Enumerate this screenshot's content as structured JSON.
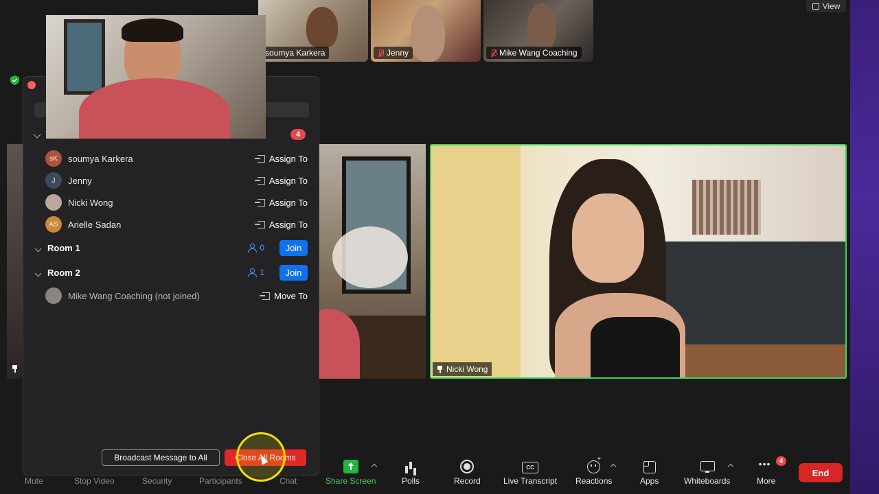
{
  "view_button": {
    "label": "View"
  },
  "thumbnails": [
    {
      "name": "soumya Karkera",
      "muted": false
    },
    {
      "name": "Jenny",
      "muted": true
    },
    {
      "name": "Mike Wang Coaching",
      "muted": true
    }
  ],
  "main_video": {
    "name": "Nicki Wong"
  },
  "breakout_panel": {
    "unassigned_count": "4",
    "participants": [
      {
        "initials": "sK",
        "name": "soumya Karkera",
        "action": "Assign To",
        "avatar_color": "#b0533d"
      },
      {
        "initials": "J",
        "name": "Jenny",
        "action": "Assign To",
        "avatar_color": "#3b4a5c"
      },
      {
        "initials": "",
        "name": "Nicki Wong",
        "action": "Assign To",
        "avatar_color": "#b8a8a0"
      },
      {
        "initials": "AS",
        "name": "Arielle Sadan",
        "action": "Assign To",
        "avatar_color": "#c9873a"
      }
    ],
    "rooms": [
      {
        "name": "Room 1",
        "count": "0",
        "action": "Join"
      },
      {
        "name": "Room 2",
        "count": "1",
        "action": "Join"
      }
    ],
    "room2_members": [
      {
        "name": "Mike Wang Coaching (not joined)",
        "action": "Move To"
      }
    ],
    "broadcast_label": "Broadcast Message to All",
    "close_all_label": "Close All Rooms"
  },
  "toolbar": {
    "mute": "Mute",
    "stop_video": "Stop Video",
    "security": "Security",
    "participants": "Participants",
    "chat": "Chat",
    "share_screen": "Share Screen",
    "polls": "Polls",
    "record": "Record",
    "live_transcript": "Live Transcript",
    "cc_text": "CC",
    "reactions": "Reactions",
    "apps": "Apps",
    "whiteboards": "Whiteboards",
    "more": "More",
    "more_badge": "4",
    "end": "End"
  },
  "colors": {
    "accent_blue": "#0e72ed",
    "end_red": "#d72626",
    "active_speaker_green": "#3fd35a",
    "share_green": "#23b540"
  }
}
